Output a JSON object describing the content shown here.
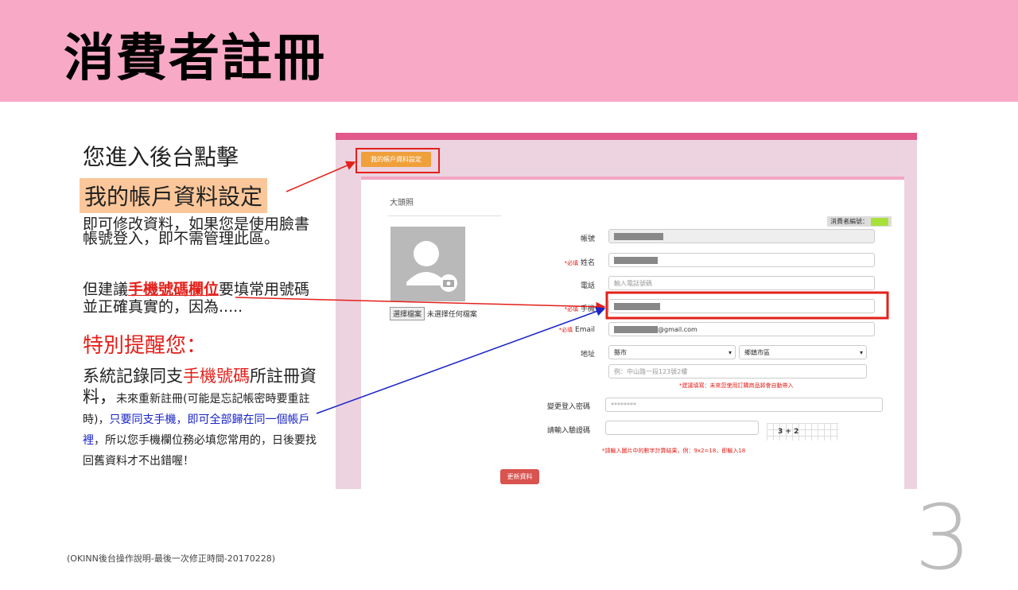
{
  "header": {
    "title": "消費者註冊"
  },
  "left": {
    "line1": "您進入後台點擊",
    "line2": "我的帳戶資料設定",
    "para1": "即可修改資料，如果您是使用臉書帳號登入，即不需管理此區。",
    "para2_a": "但建議",
    "para2_highlight": "手機號碼欄位",
    "para2_b": "要填常用號碼並正確真實的，因為.....",
    "reminder": "特別提醒您：",
    "para3_a": "系統記錄同支",
    "para3_highlight": "手機號碼",
    "para3_b": "所註冊資料，",
    "para3_c": "未來重新註冊(可能是忘記帳密時要重註時)，",
    "para3_blue": "只要同支手機，即可全部歸在同一個帳戶裡",
    "para3_d": "，所以您手機欄位務必填您常用的，日後要找回舊資料才不出錯喔！"
  },
  "footer": "(OKINN後台操作說明-最後一次修正時間-20170228)",
  "page_number": "3",
  "screenshot": {
    "account_button": "我的帳戶資料設定",
    "avatar_label": "大頭照",
    "choose_file": "選擇檔案",
    "no_file": "未選擇任何檔案",
    "member_no_label": "消費者編號：",
    "fields": {
      "account": "帳號",
      "required": "*必填",
      "name": "姓名",
      "phone": "電話",
      "phone_placeholder": "輸入電話號碼",
      "mobile": "手機",
      "email": "Email",
      "email_value": "@gmail.com",
      "address": "地址",
      "city": "縣市",
      "district": "鄉鎮市區",
      "address_placeholder": "例：中山路一段123號2樓",
      "address_note": "*建議填寫：未來您使用訂購商品將會自動帶入",
      "password": "變更登入密碼",
      "password_value": "********",
      "captcha": "請輸入驗證碼",
      "captcha_text": "3 + 2",
      "captcha_note": "*請輸入圖片中的數字計算結果，例：9x2=18，即輸入18"
    },
    "update_button": "更新資料"
  },
  "colors": {
    "header_bg": "#f8a9c6",
    "highlight": "#fbc79a",
    "red": "#e3201a",
    "blue": "#1a24c8"
  }
}
